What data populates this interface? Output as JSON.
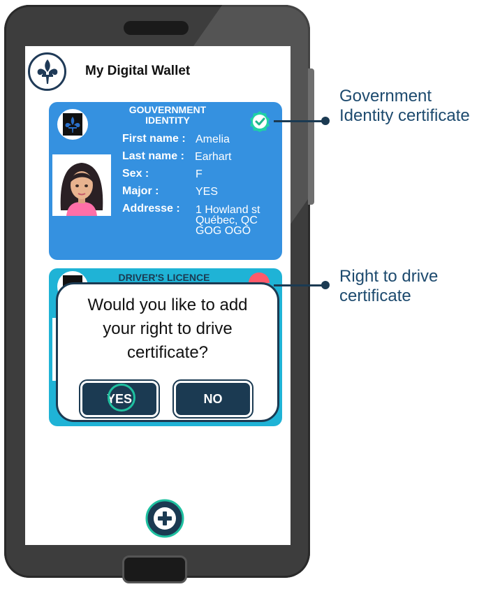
{
  "app": {
    "title": "My Digital Wallet"
  },
  "id_card": {
    "title_line1": "GOUVERNMENT",
    "title_line2": "IDENTITY",
    "fields": [
      {
        "label": "First name :",
        "value": "Amelia"
      },
      {
        "label": "Last name :",
        "value": "Earhart"
      },
      {
        "label": "Sex :",
        "value": "F"
      },
      {
        "label": "Major :",
        "value": "YES"
      },
      {
        "label": "Addresse :",
        "value_lines": [
          "1 Howland st",
          "Québec, QC",
          "GOG OGO"
        ]
      }
    ],
    "verified_icon": "check-badge-icon"
  },
  "licence_card": {
    "title": "DRIVER'S LICENCE"
  },
  "dialog": {
    "lines": [
      "Would you like to add",
      "your right to drive",
      "certificate?"
    ],
    "yes_label": "YES",
    "no_label": "NO"
  },
  "add_button_icon": "plus-icon",
  "callouts": {
    "gov": [
      "Government",
      "Identity certificate"
    ],
    "drive": [
      "Right to drive",
      "certificate"
    ]
  },
  "colors": {
    "id_card": "#3591e0",
    "licence_card": "#1fb3d6",
    "dark_navy": "#1b3a52",
    "accent_green": "#1fc0a0"
  }
}
